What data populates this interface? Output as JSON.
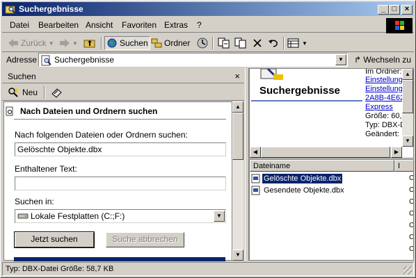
{
  "window": {
    "title": "Suchergebnisse",
    "controls": {
      "minimize": "_",
      "maximize": "□",
      "close": "×"
    }
  },
  "menu": [
    "Datei",
    "Bearbeiten",
    "Ansicht",
    "Favoriten",
    "Extras",
    "?"
  ],
  "toolbar": {
    "back": "Zurück",
    "search": "Suchen",
    "folders": "Ordner"
  },
  "address": {
    "label": "Adresse",
    "value": "Suchergebnisse",
    "go": "Wechseln zu"
  },
  "search_pane": {
    "header": "Suchen",
    "close": "×",
    "new_label": "Neu",
    "section_title": "Nach Dateien und Ordnern suchen",
    "filename_label": "Nach folgenden Dateien oder Ordnern suchen:",
    "filename_value": "Gelöschte Objekte.dbx",
    "text_label": "Enthaltener Text:",
    "text_value": "",
    "lookin_label": "Suchen in:",
    "lookin_value": "Lokale Festplatten (C:;F:)",
    "search_button": "Jetzt suchen",
    "stop_button": "Suche abbrechen"
  },
  "info_pane": {
    "title": "Suchergebnisse",
    "lines": [
      {
        "text": "Im Ordner:",
        "link": false
      },
      {
        "text": "Einstellung",
        "link": true
      },
      {
        "text": "Einstellung",
        "link": true
      },
      {
        "text": "2A8B-4E62",
        "link": true
      },
      {
        "text": "Express",
        "link": true
      },
      {
        "text": "Größe: 60,",
        "link": false
      },
      {
        "text": "Typ: DBX-D",
        "link": false
      },
      {
        "text": "Geändert: ",
        "link": false
      }
    ]
  },
  "results": {
    "columns": [
      "Dateiname",
      "I"
    ],
    "rows": [
      {
        "name": "Gelöschte Objekte.dbx",
        "selected": true
      },
      {
        "name": "Gesendete Objekte.dbx",
        "selected": false
      }
    ]
  },
  "status": "Typ: DBX-Datei Größe: 58,7 KB"
}
